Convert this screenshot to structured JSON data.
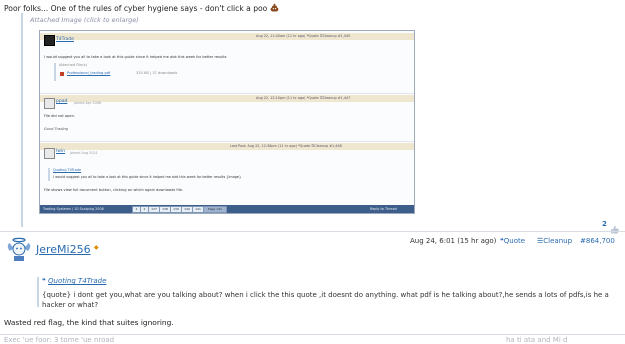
{
  "post1": {
    "text": "Poor folks... One of the rules of cyber hygiene says - don't click a poo",
    "attached_label": "Attached Image (click to enlarge)",
    "like_count": "2",
    "nested": {
      "post_a": {
        "user": "T4Trade",
        "meta": "Aug 22, 11:40am (11 hr ago)   ❝Quote   ☰Cleanup   #1,445",
        "text": "I would suggest you all to take a look at this guide since it helped me alot this week for better results",
        "attached_files": "Attached File(s)",
        "file_name": "Professional_trading.pdf",
        "file_meta": "330 KB  |  37 downloads"
      },
      "post_b": {
        "user": "ppad",
        "joined": "Joined Apr 2006",
        "meta": "Aug 22, 12:10pm (11 hr ago)   ❝Quote   ☰Cleanup   #1,447",
        "text1": "File did not open.",
        "text2": "Good Trading"
      },
      "post_c": {
        "user": "lwin",
        "joined": "Joined Aug 2021",
        "meta": "Last Post: Aug 22, 12:38pm (11 hr ago)   ❝Quote   ☰Cleanup   #1,448",
        "quote_label": "Quoting T4Trade",
        "quote_text": "I would suggest you all to take a look at this guide since it helped me alot this week for better results {image}",
        "text": "File shows view full document button, clicking on which again downloads file."
      },
      "footer_left": "Trading Systems / 10 Scalping 2008",
      "pages": [
        "1",
        "2",
        "137",
        "138",
        "139",
        "140",
        "141"
      ],
      "page_current": "Page 141",
      "footer_right": "Reply to Thread"
    }
  },
  "post2": {
    "user": "JereMi256",
    "date": "Aug 24, 6:01 (15 hr ago)",
    "quote_btn": "Quote",
    "cleanup_btn": "Cleanup",
    "post_num": "#864,700",
    "quoting_label": "Quoting T4Trade",
    "quote_text": "{quote} i dont get you,what are you talking about? when i click the this quote ,it doesnt do anything. what pdf is he talking about?,he sends a lots of pdfs,is he a hacker or what?",
    "text": "Wasted red flag, the kind that suites ignoring.",
    "cut_left": "Exec 'ue foor: 3 tome 'ue nroad",
    "cut_right": "ha ti  ata  and  Mi  d"
  }
}
